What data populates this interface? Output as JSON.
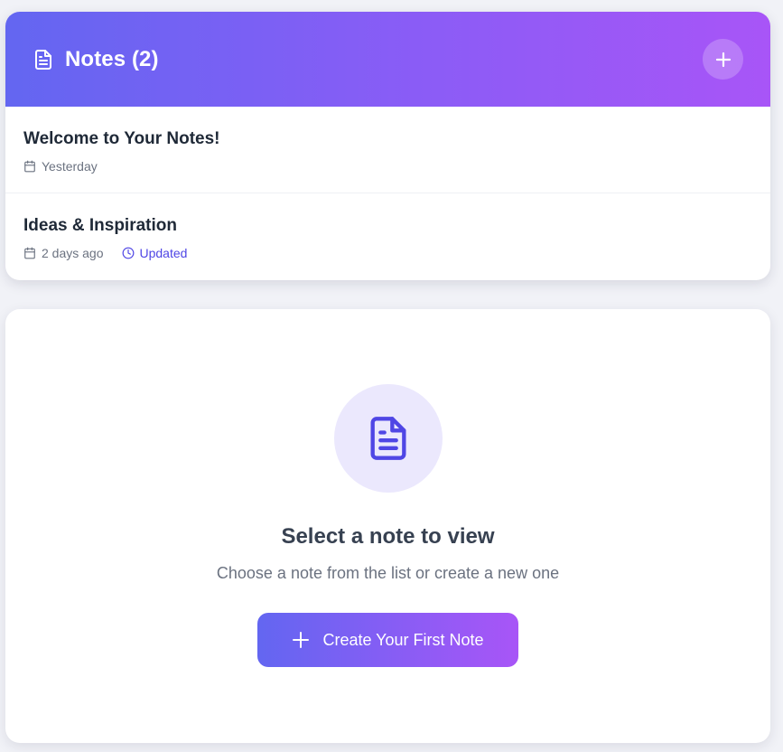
{
  "header": {
    "title": "Notes (2)",
    "icon": "document-icon",
    "add_icon": "plus-icon"
  },
  "notes": [
    {
      "title": "Welcome to Your Notes!",
      "date": "Yesterday",
      "updated": ""
    },
    {
      "title": "Ideas & Inspiration",
      "date": "2 days ago",
      "updated": "Updated"
    }
  ],
  "viewer": {
    "icon": "document-icon",
    "title": "Select a note to view",
    "subtitle": "Choose a note from the list or create a new one",
    "create_label": "Create Your First Note"
  },
  "colors": {
    "gradient_start": "#6366f1",
    "gradient_end": "#a855f7",
    "accent": "#4f46e5"
  }
}
